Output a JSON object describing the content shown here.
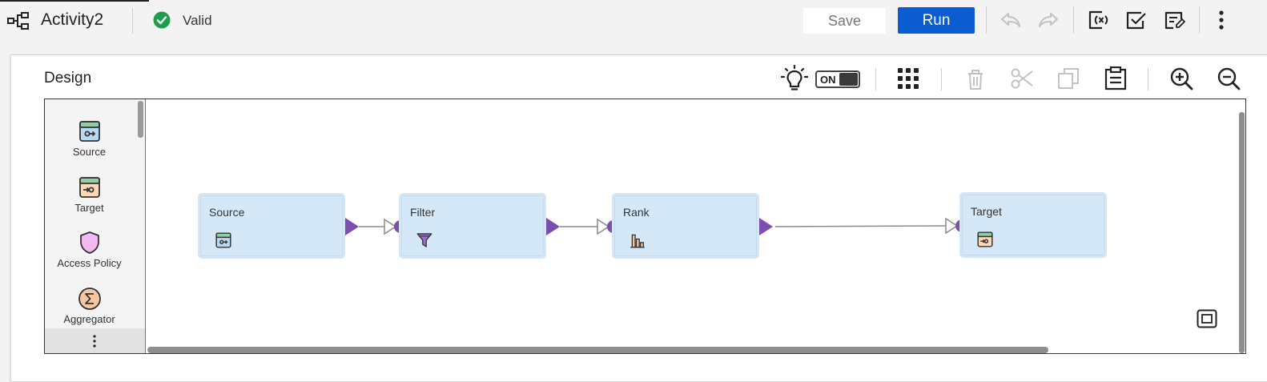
{
  "header": {
    "title": "Activity2",
    "status": "Valid",
    "save_label": "Save",
    "run_label": "Run",
    "icons": [
      "mapping-icon",
      "valid-check-icon",
      "undo-icon",
      "redo-icon",
      "parameters-icon",
      "validate-icon",
      "properties-icon",
      "more-vertical-icon"
    ]
  },
  "design": {
    "title": "Design",
    "toggle_label": "ON",
    "toolbar_icons": [
      "lightbulb-icon",
      "arrange-grid-icon",
      "delete-icon",
      "cut-icon",
      "copy-icon",
      "paste-icon",
      "zoom-in-icon",
      "zoom-out-icon"
    ]
  },
  "palette": {
    "items": [
      {
        "label": "Source",
        "icon": "source-icon"
      },
      {
        "label": "Target",
        "icon": "target-icon"
      },
      {
        "label": "Access Policy",
        "icon": "shield-icon"
      },
      {
        "label": "Aggregator",
        "icon": "sigma-icon"
      }
    ],
    "more_icon": "more-vertical-icon"
  },
  "canvas": {
    "nodes": [
      {
        "label": "Source",
        "icon": "source-icon"
      },
      {
        "label": "Filter",
        "icon": "funnel-icon"
      },
      {
        "label": "Rank",
        "icon": "rank-chart-icon"
      },
      {
        "label": "Target",
        "icon": "target-icon"
      }
    ],
    "fit_icon": "fit-to-screen-icon"
  },
  "colors": {
    "run_button": "#0b5cd0",
    "valid_green": "#1e9e4a",
    "node_fill": "#d4e8f8",
    "port_purple": "#7a4fb0",
    "canvas_border": "#0a3d91"
  }
}
